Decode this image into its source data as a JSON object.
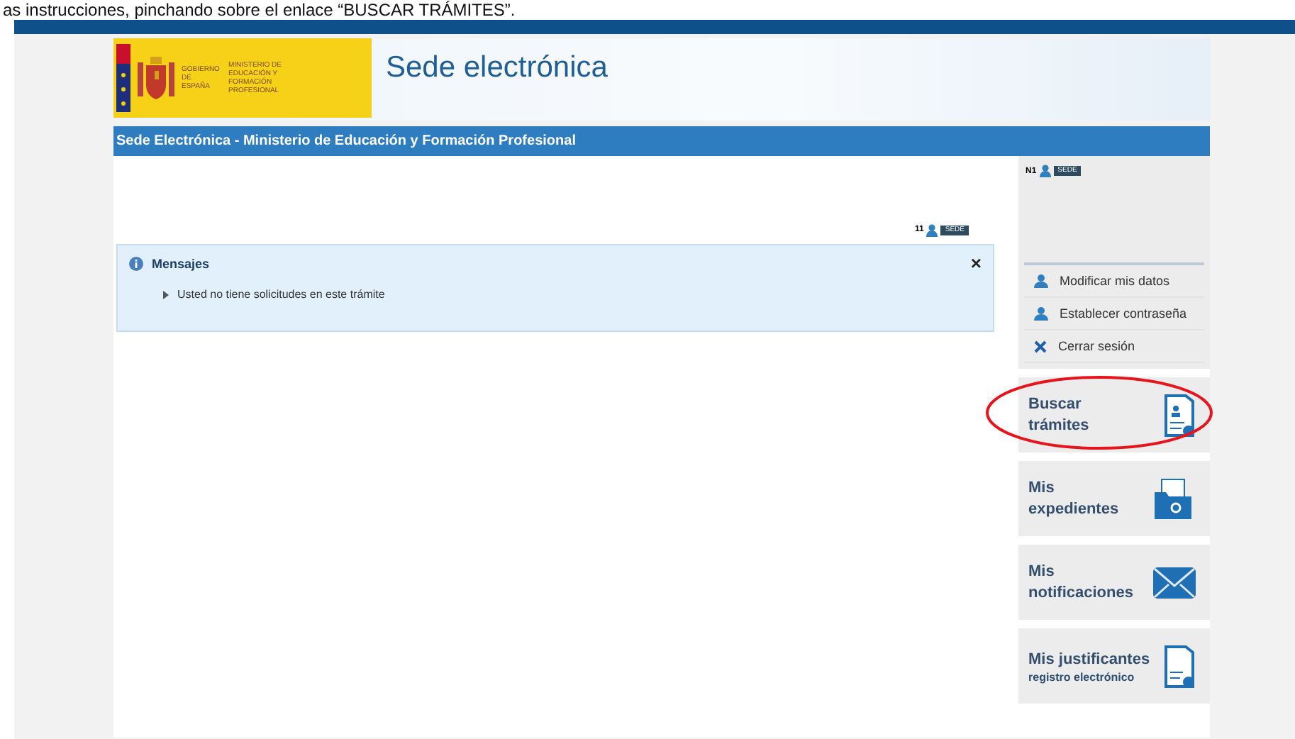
{
  "document_text": "as instrucciones, pinchando sobre el enlace “BUSCAR TRÁMITES”.",
  "header": {
    "gov_label": "GOBIERNO DE ESPAÑA",
    "ministry_label": "MINISTERIO DE EDUCACIÓN Y FORMACIÓN PROFESIONAL",
    "title": "Sede electrónica"
  },
  "nav_title": "Sede Electrónica - Ministerio de Educación y Formación Profesional",
  "user_level": "11",
  "user_badge": "SEDE",
  "messages": {
    "title": "Mensajes",
    "close": "×",
    "items": [
      "Usted no tiene solicitudes en este trámite"
    ]
  },
  "user_panel": {
    "level": "N1",
    "badge": "SEDE",
    "actions": [
      {
        "kind": "user",
        "label": "Modificar mis datos"
      },
      {
        "kind": "user",
        "label": "Establecer contraseña"
      },
      {
        "kind": "close",
        "label": "Cerrar sesión"
      }
    ]
  },
  "tiles": [
    {
      "kind": "search-doc",
      "title": "Buscar trámites",
      "highlighted": true
    },
    {
      "kind": "folder",
      "title": "Mis expedientes",
      "highlighted": false
    },
    {
      "kind": "mail",
      "title": "Mis notificaciones",
      "highlighted": false
    },
    {
      "kind": "receipt",
      "title": "Mis justificantes",
      "subtitle": "registro electrónico",
      "highlighted": false
    }
  ]
}
